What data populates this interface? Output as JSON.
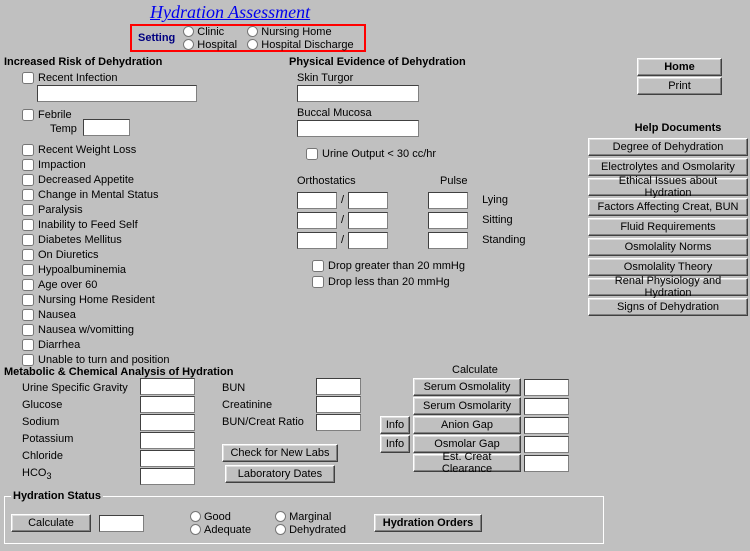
{
  "title": "Hydration Assessment",
  "setting": {
    "label": "Setting",
    "options": {
      "clinic": "Clinic",
      "nursing_home": "Nursing Home",
      "hospital": "Hospital",
      "hospital_discharge": "Hospital Discharge"
    }
  },
  "risk": {
    "heading": "Increased Risk of Dehydration",
    "recent_infection": "Recent Infection",
    "recent_infection_val": "",
    "febrile": "Febrile",
    "temp_label": "Temp",
    "temp_val": "",
    "items": [
      "Recent Weight Loss",
      "Impaction",
      "Decreased Appetite",
      "Change in Mental Status",
      "Paralysis",
      "Inability to Feed Self",
      "Diabetes Mellitus",
      "On Diuretics",
      "Hypoalbuminemia",
      "Age over 60",
      "Nursing Home Resident",
      "Nausea",
      "Nausea w/vomitting",
      "Diarrhea",
      "Unable to turn and position"
    ]
  },
  "physical": {
    "heading": "Physical Evidence of Dehydration",
    "skin_turgor": "Skin Turgor",
    "skin_turgor_val": "",
    "buccal_mucosa": "Buccal Mucosa",
    "buccal_mucosa_val": "",
    "urine_output": "Urine Output < 30 cc/hr",
    "orthostatics": "Orthostatics",
    "pulse": "Pulse",
    "lying": "Lying",
    "sitting": "Sitting",
    "standing": "Standing",
    "slash": "/",
    "drop_gt": "Drop greater than 20 mmHg",
    "drop_lt": "Drop less than 20 mmHg"
  },
  "right": {
    "home": "Home",
    "print": "Print",
    "help_heading": "Help Documents",
    "docs": [
      "Degree of Dehydration",
      "Electrolytes and Osmolarity",
      "Ethical Issues about Hydration",
      "Factors Affecting Creat, BUN",
      "Fluid Requirements",
      "Osmolality Norms",
      "Osmolality Theory",
      "Renal Physiology and Hydration",
      "Signs of Dehydration"
    ]
  },
  "metabolic": {
    "heading": "Metabolic & Chemical Analysis of Hydration",
    "urine_sg": "Urine Specific Gravity",
    "glucose": "Glucose",
    "sodium": "Sodium",
    "potassium": "Potassium",
    "chloride": "Chloride",
    "hco3": "HCO",
    "bun": "BUN",
    "creatinine": "Creatinine",
    "bun_creat": "BUN/Creat Ratio",
    "check_labs": "Check for New Labs",
    "lab_dates": "Laboratory Dates",
    "calculate": "Calculate",
    "serum_osmolality": "Serum Osmolality",
    "serum_osmolarity": "Serum Osmolarity",
    "anion_gap": "Anion Gap",
    "osmolar_gap": "Osmolar Gap",
    "est_creat": "Est. Creat Clearance",
    "info": "Info"
  },
  "status": {
    "heading": "Hydration Status",
    "calculate": "Calculate",
    "good": "Good",
    "adequate": "Adequate",
    "marginal": "Marginal",
    "dehydrated": "Dehydrated",
    "orders": "Hydration Orders"
  }
}
